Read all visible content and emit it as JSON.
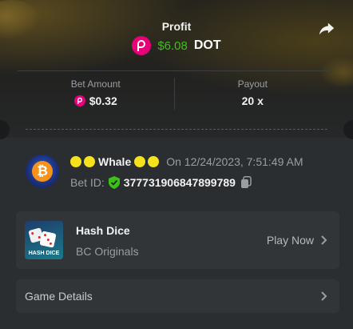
{
  "header": {
    "profit_label": "Profit",
    "profit_amount": "$6.08",
    "profit_currency": "DOT",
    "share_icon": "share-icon"
  },
  "stats": {
    "bet_amount_label": "Bet Amount",
    "bet_amount_value": "$0.32",
    "payout_label": "Payout",
    "payout_value": "20 x"
  },
  "user": {
    "username": "Whale",
    "timestamp": "On 12/24/2023, 7:51:49 AM",
    "bet_id_label": "Bet ID:",
    "bet_id": "377731906847899789"
  },
  "game": {
    "name": "Hash Dice",
    "provider": "BC Originals",
    "thumb_text": "HASH DICE",
    "play_label": "Play Now"
  },
  "details": {
    "label": "Game Details"
  },
  "colors": {
    "profit_green": "#3bc117",
    "polkadot_pink": "#e6007a",
    "background": "#2b2e31",
    "card": "#323538"
  }
}
